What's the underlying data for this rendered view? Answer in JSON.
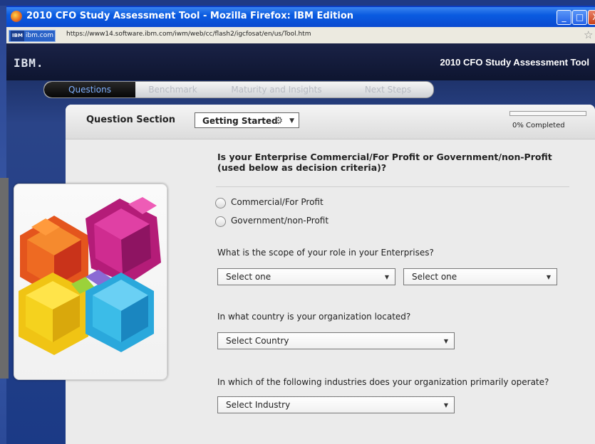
{
  "window": {
    "title": "2010 CFO Study Assessment Tool - Mozilla Firefox: IBM Edition",
    "min_glyph": "_",
    "max_glyph": "□",
    "close_glyph": "X"
  },
  "address": {
    "site_badge": "ibm.com",
    "site_badge_prefix": "IBM",
    "url": "https://www14.software.ibm.com/iwm/web/cc/flash2/igcfosat/en/us/Tool.htm",
    "star_glyph": "☆"
  },
  "app": {
    "logo": "IBM.",
    "title": "2010 CFO Study Assessment Tool"
  },
  "tabs": [
    {
      "label": "Questions"
    },
    {
      "label": "Benchmark"
    },
    {
      "label": "Maturity and Insights"
    },
    {
      "label": "Next Steps"
    }
  ],
  "panel": {
    "section_label": "Question Section",
    "section_dropdown": "Getting Started",
    "progress": {
      "percent": 0,
      "text": "0% Completed"
    }
  },
  "questions": {
    "q1": "Is your Enterprise Commercial/For Profit or Government/non-Profit (used below as decision criteria)?",
    "q1_options": [
      "Commercial/For Profit",
      "Government/non-Profit"
    ],
    "q2": "What is the scope of your role in your Enterprises?",
    "q2_selects": [
      "Select one",
      "Select one"
    ],
    "q3": "In what country is your organization located?",
    "q3_select": "Select Country",
    "q4": "In which of the following industries does your organization primarily operate?",
    "q4_select": "Select Industry"
  },
  "colors": {
    "titlebar": "#0a5be0",
    "accent_tab_text": "#7fb0ff",
    "cube_orange": "#f07a2a",
    "cube_magenta": "#d0238e",
    "cube_yellow": "#f2d21c",
    "cube_cyan": "#35b8e8"
  }
}
